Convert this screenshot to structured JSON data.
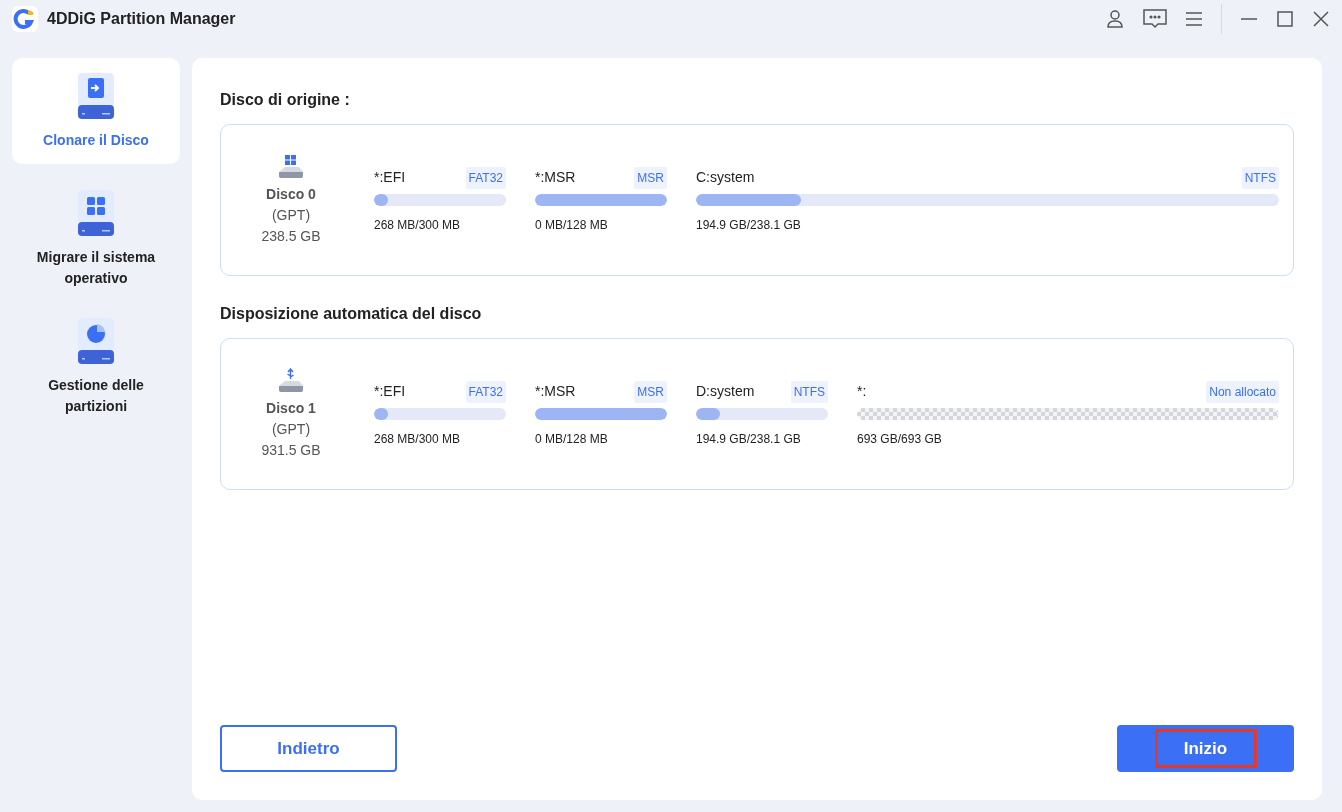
{
  "window": {
    "title": "4DDiG Partition Manager"
  },
  "sidebar": {
    "items": [
      {
        "kind": "clone",
        "label": "Clonare il Disco",
        "selected": true
      },
      {
        "kind": "grid",
        "label": "Migrare il sistema operativo",
        "selected": false
      },
      {
        "kind": "pie",
        "label": "Gestione delle partizioni",
        "selected": false
      }
    ]
  },
  "sections": [
    {
      "heading": "Disco di origine :",
      "disk": {
        "kind": "windows",
        "name": "Disco 0",
        "style": "(GPT)",
        "size": "238.5 GB"
      },
      "partitions": [
        {
          "kind": "used",
          "name": "*:EFI",
          "fs": "FAT32",
          "level": 0.05,
          "usage": "268 MB/300 MB"
        },
        {
          "kind": "used",
          "name": "*:MSR",
          "fs": "MSR",
          "level": 1,
          "usage": "0 MB/128 MB"
        },
        {
          "kind": "used",
          "name": "C:system",
          "fs": "NTFS",
          "level": 0.18,
          "usage": "194.9 GB/238.1 GB"
        }
      ]
    },
    {
      "heading": "Disposizione automatica del disco",
      "disk": {
        "kind": "usb",
        "name": "Disco 1",
        "style": "(GPT)",
        "size": "931.5 GB"
      },
      "partitions": [
        {
          "kind": "used",
          "name": "*:EFI",
          "fs": "FAT32",
          "level": 0.05,
          "usage": "268 MB/300 MB"
        },
        {
          "kind": "used",
          "name": "*:MSR",
          "fs": "MSR",
          "level": 1,
          "usage": "0 MB/128 MB"
        },
        {
          "kind": "used",
          "name": "D:system",
          "fs": "NTFS",
          "level": 0.18,
          "usage": "194.9 GB/238.1 GB"
        },
        {
          "kind": "unallocated",
          "name": "*:",
          "fs": "Non allocato",
          "usage": "693 GB/693 GB"
        }
      ]
    }
  ],
  "buttons": {
    "back": {
      "label": "Indietro"
    },
    "start": {
      "label": "Inizio",
      "highlighted": true
    }
  }
}
